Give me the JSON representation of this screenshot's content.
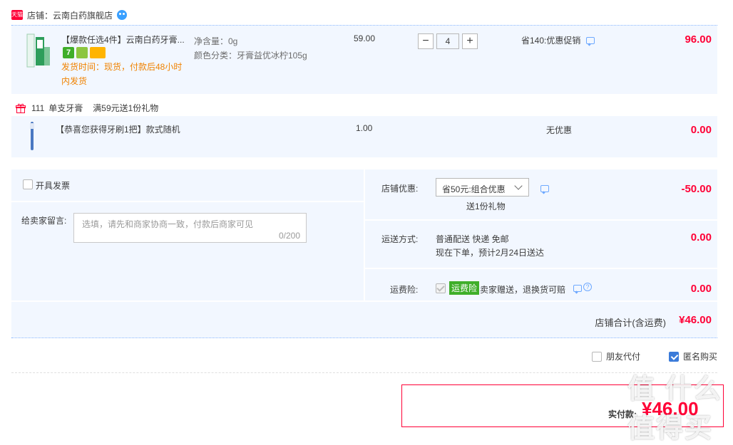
{
  "shop": {
    "badge_text": "天猫",
    "name": "店铺：云南白药旗舰店"
  },
  "main_item": {
    "title": "【爆款任选4件】云南白药牙膏...",
    "spec_weight": "净含量：0g",
    "spec_color": "颜色分类：牙膏益优冰柠105g",
    "ship_line1": "发货时间：现货，付款后48小时",
    "ship_line2": "内发货",
    "unit_price": "59.00",
    "quantity": "4",
    "minus": "−",
    "plus": "+",
    "promo": "省140:优惠促销",
    "total": "96.00"
  },
  "gift": {
    "header_id": "111",
    "header_product": "单支牙膏",
    "header_rule": "满59元送1份礼物",
    "title": "【恭喜您获得牙刷1把】款式随机",
    "unit_price": "1.00",
    "promo": "无优惠",
    "total": "0.00"
  },
  "invoice": {
    "label": "开具发票"
  },
  "message": {
    "label": "给卖家留言:",
    "placeholder": "选填，请先和商家协商一致，付款后商家可见",
    "counter": "0/200"
  },
  "shop_discount": {
    "label": "店铺优惠:",
    "selected": "省50元:组合优惠",
    "gift_note": "送1份礼物",
    "amount": "-50.00"
  },
  "shipping": {
    "label": "运送方式:",
    "method": "普通配送 快递 免邮",
    "eta": "现在下单，预计2月24日送达",
    "amount": "0.00"
  },
  "insurance": {
    "label": "运费险:",
    "tag": "运费险",
    "desc": "卖家赠送，退换货可赔",
    "amount": "0.00"
  },
  "shop_total": {
    "label": "店铺合计(含运费)",
    "amount": "¥46.00"
  },
  "options": {
    "friend_pay": "朋友代付",
    "anonymous": "匿名购买"
  },
  "payment": {
    "label": "实付款:",
    "amount": "¥46.00"
  },
  "watermark": "值 什么值得买",
  "colors": {
    "accent_red": "#ff0036",
    "band_bg": "#f2f7ff",
    "link_blue": "#6ea9ff",
    "ship_orange": "#f08200"
  }
}
